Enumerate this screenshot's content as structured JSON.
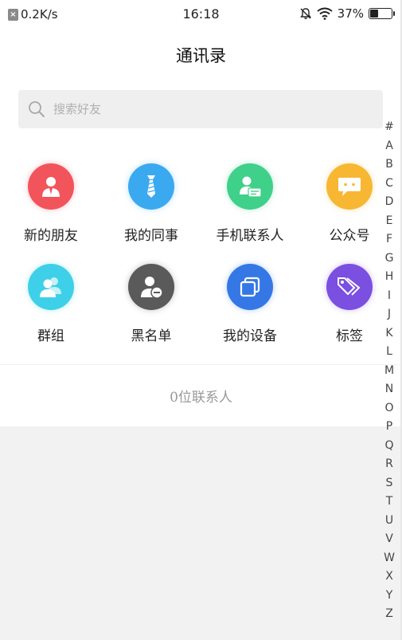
{
  "status_bar": {
    "speed": "0.2K/s",
    "time": "16:18",
    "battery_text": "37%",
    "battery_level": 0.37
  },
  "header": {
    "title": "通讯录"
  },
  "search": {
    "placeholder": "搜索好友",
    "value": ""
  },
  "grid": [
    {
      "label": "新的朋友",
      "icon": "person-suit-icon",
      "color": "#f2545b"
    },
    {
      "label": "我的同事",
      "icon": "tie-icon",
      "color": "#3aa9f0"
    },
    {
      "label": "手机联系人",
      "icon": "contact-card-icon",
      "color": "#3fd08a"
    },
    {
      "label": "公众号",
      "icon": "chat-bubble-icon",
      "color": "#f7b733"
    },
    {
      "label": "群组",
      "icon": "group-icon",
      "color": "#3ed0e8"
    },
    {
      "label": "黑名单",
      "icon": "block-user-icon",
      "color": "#5a5a5a"
    },
    {
      "label": "我的设备",
      "icon": "devices-icon",
      "color": "#3578e5"
    },
    {
      "label": "标签",
      "icon": "tag-icon",
      "color": "#7b4fe0"
    }
  ],
  "contact_count": "0位联系人",
  "alpha_index": [
    "#",
    "A",
    "B",
    "C",
    "D",
    "E",
    "F",
    "G",
    "H",
    "I",
    "J",
    "K",
    "L",
    "M",
    "N",
    "O",
    "P",
    "Q",
    "R",
    "S",
    "T",
    "U",
    "V",
    "W",
    "X",
    "Y",
    "Z"
  ]
}
